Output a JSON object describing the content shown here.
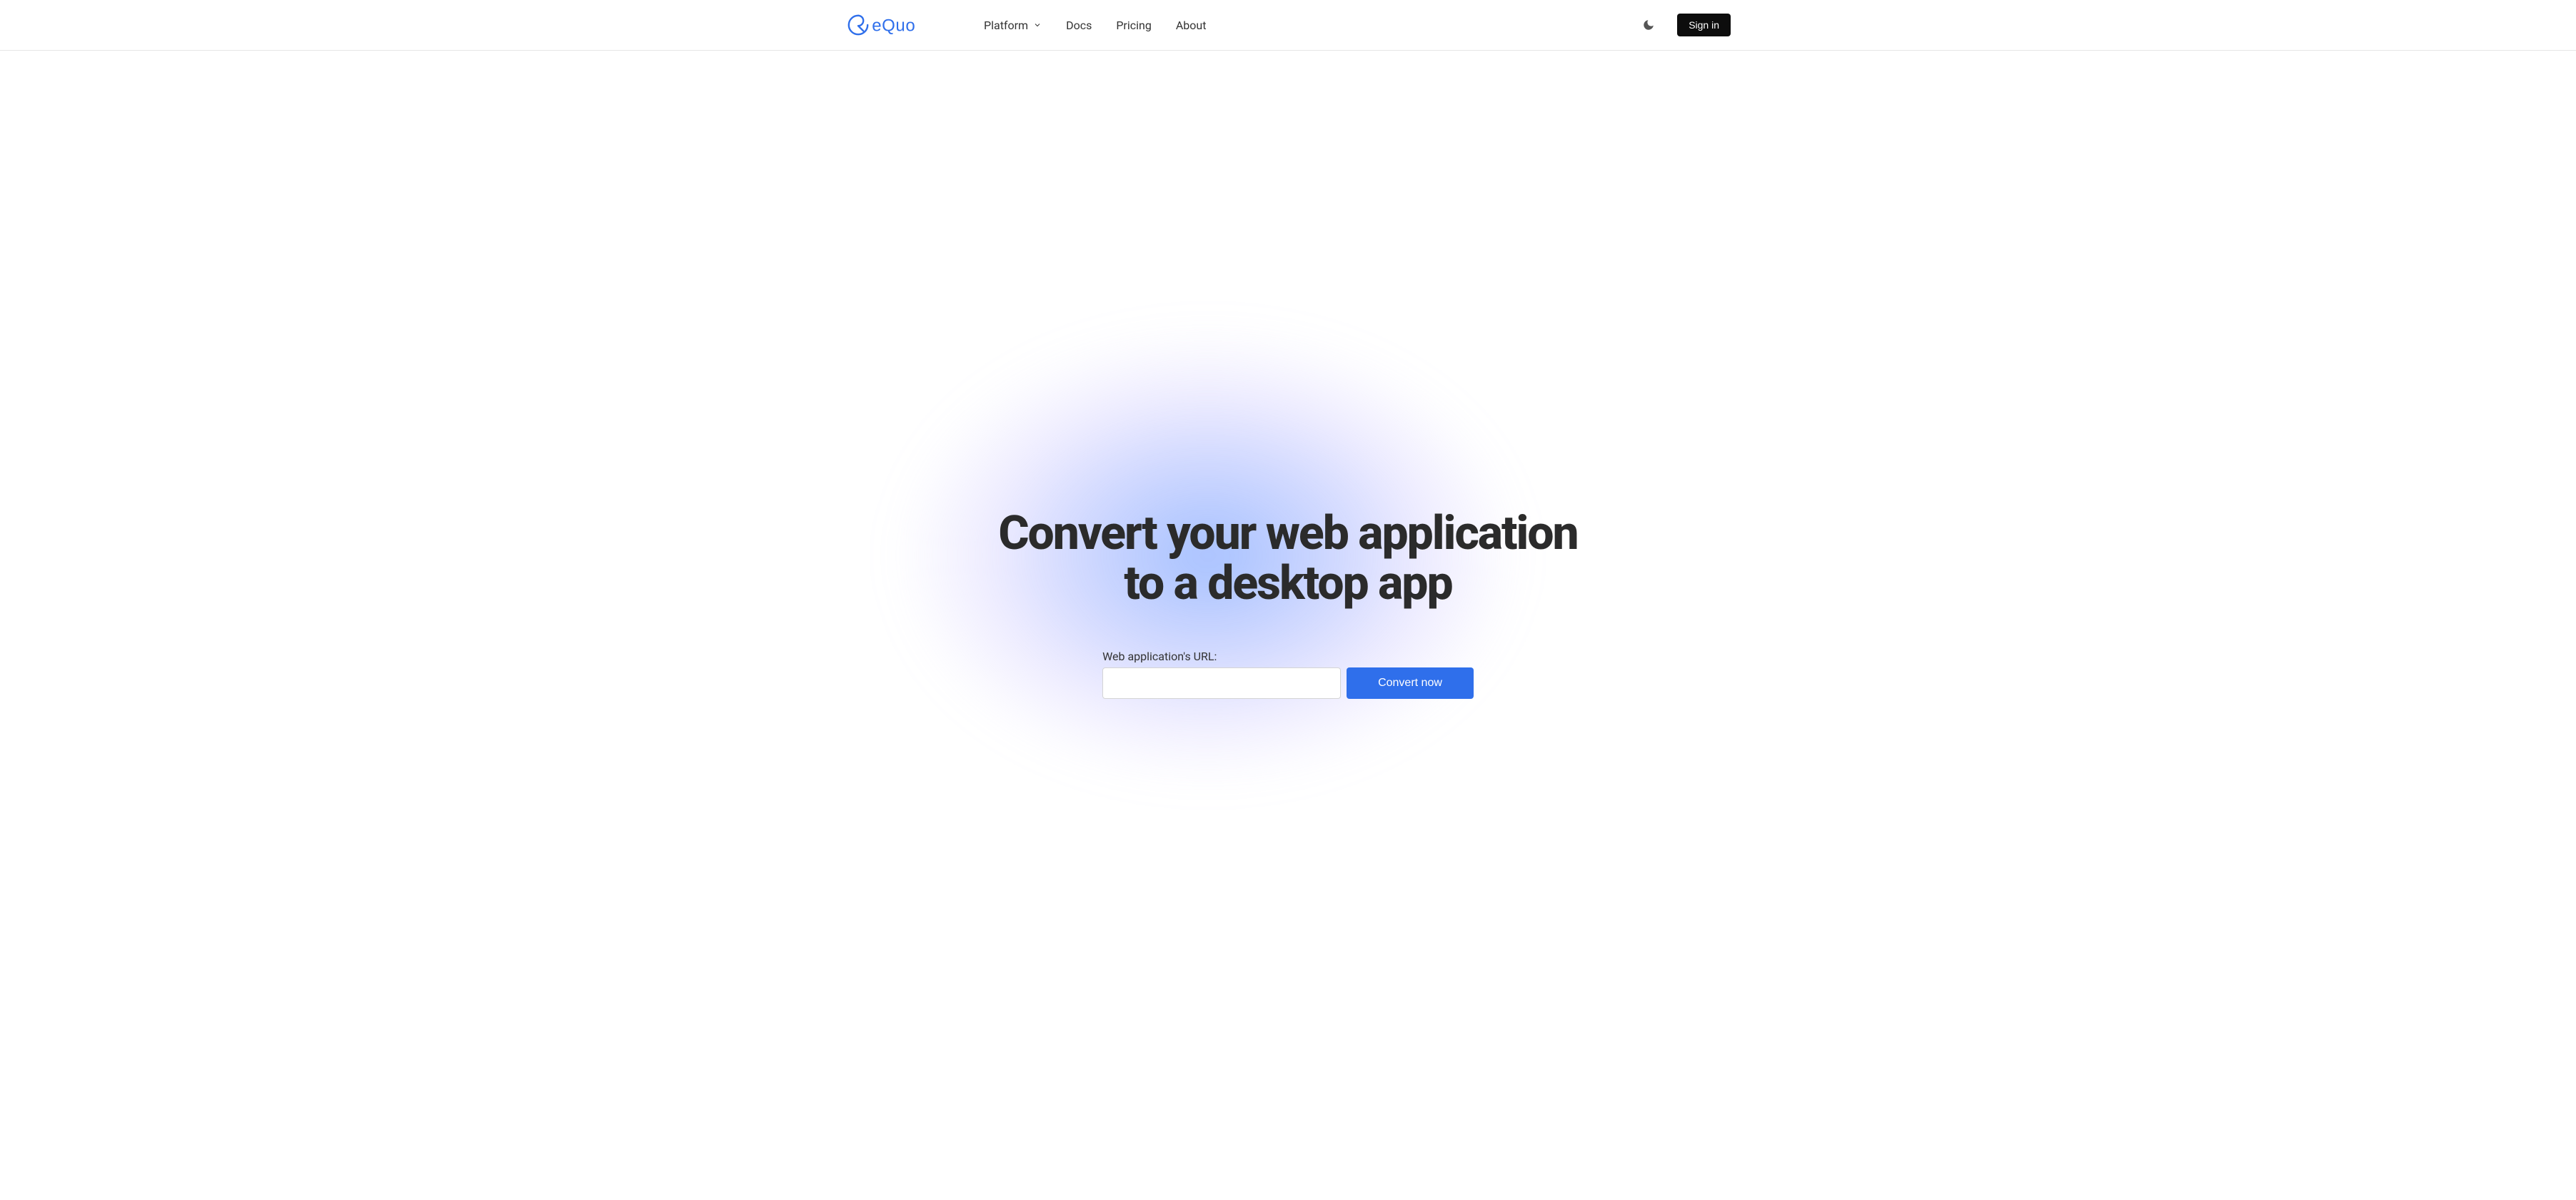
{
  "brand": {
    "name": "equo"
  },
  "nav": {
    "items": [
      {
        "label": "Platform",
        "has_dropdown": true
      },
      {
        "label": "Docs",
        "has_dropdown": false
      },
      {
        "label": "Pricing",
        "has_dropdown": false
      },
      {
        "label": "About",
        "has_dropdown": false
      }
    ]
  },
  "header": {
    "sign_in_label": "Sign in"
  },
  "hero": {
    "title_line1": "Convert your web application",
    "title_line2": "to a desktop app",
    "form_label": "Web application's URL:",
    "input_value": "",
    "convert_button_label": "Convert now"
  },
  "colors": {
    "brand": "#2f6feb",
    "text": "#2d2d2d",
    "button_dark": "#0d0d0d"
  }
}
